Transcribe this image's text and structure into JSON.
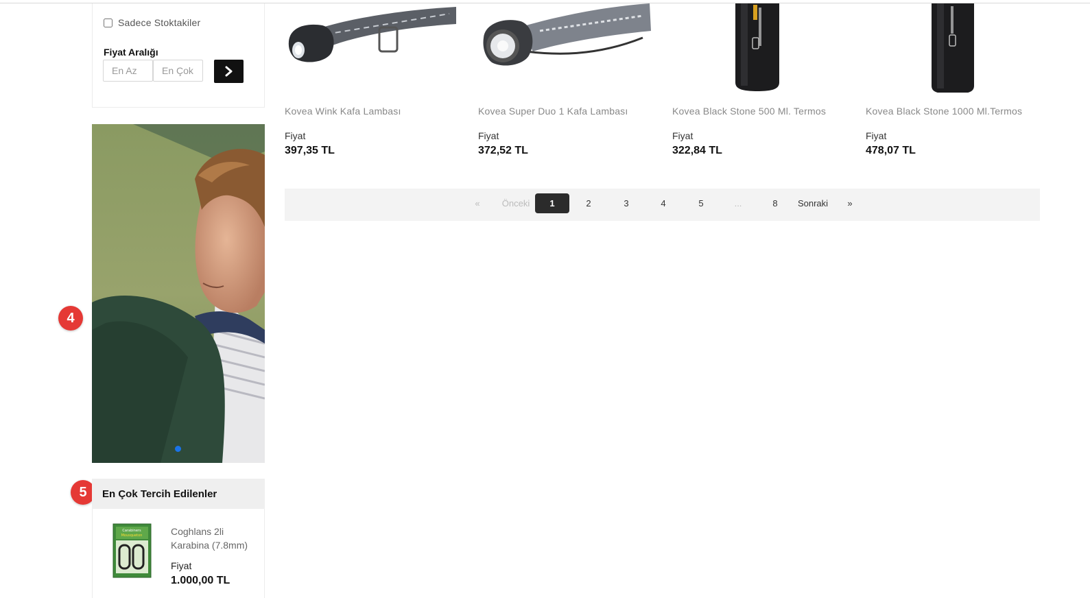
{
  "filters": {
    "in_stock_label": "Sadece Stoktakiler",
    "in_stock_checked": false,
    "price_range_title": "Fiyat Aralığı",
    "min_placeholder": "En Az",
    "max_placeholder": "En Çok",
    "min_value": "",
    "max_value": "",
    "apply_icon": "chevron-right-icon"
  },
  "banner": {
    "slide_count": 1,
    "active_slide": 1,
    "indicator_color": "#1a73e8"
  },
  "markers": [
    "4",
    "5"
  ],
  "products": [
    {
      "name": "Kovea Wink Kafa Lambası",
      "price_label": "Fiyat",
      "price": "397,35 TL",
      "image_icon": "headlamp-icon"
    },
    {
      "name": "Kovea Super Duo 1 Kafa Lambası",
      "price_label": "Fiyat",
      "price": "372,52 TL",
      "image_icon": "headlamp-icon"
    },
    {
      "name": "Kovea Black Stone 500 Ml. Termos",
      "price_label": "Fiyat",
      "price": "322,84 TL",
      "image_icon": "thermos-icon"
    },
    {
      "name": "Kovea Black Stone 1000 Ml.Termos",
      "price_label": "Fiyat",
      "price": "478,07 TL",
      "image_icon": "thermos-icon"
    }
  ],
  "pagination": {
    "first": "«",
    "prev": "Önceki",
    "pages": [
      "1",
      "2",
      "3",
      "4",
      "5"
    ],
    "ellipsis": "...",
    "last_page": "8",
    "next": "Sonraki",
    "last": "»",
    "current": "1"
  },
  "popular": {
    "title": "En Çok Tercih Edilenler",
    "items": [
      {
        "name": "Coghlans 2li Karabina (7.8mm)",
        "price_label": "Fiyat",
        "price": "1.000,00 TL",
        "image_icon": "carabiner-package-icon"
      }
    ]
  },
  "colors": {
    "accent_dark": "#111111",
    "marker_red": "#e53935",
    "pagination_bg": "#f3f3f3"
  }
}
